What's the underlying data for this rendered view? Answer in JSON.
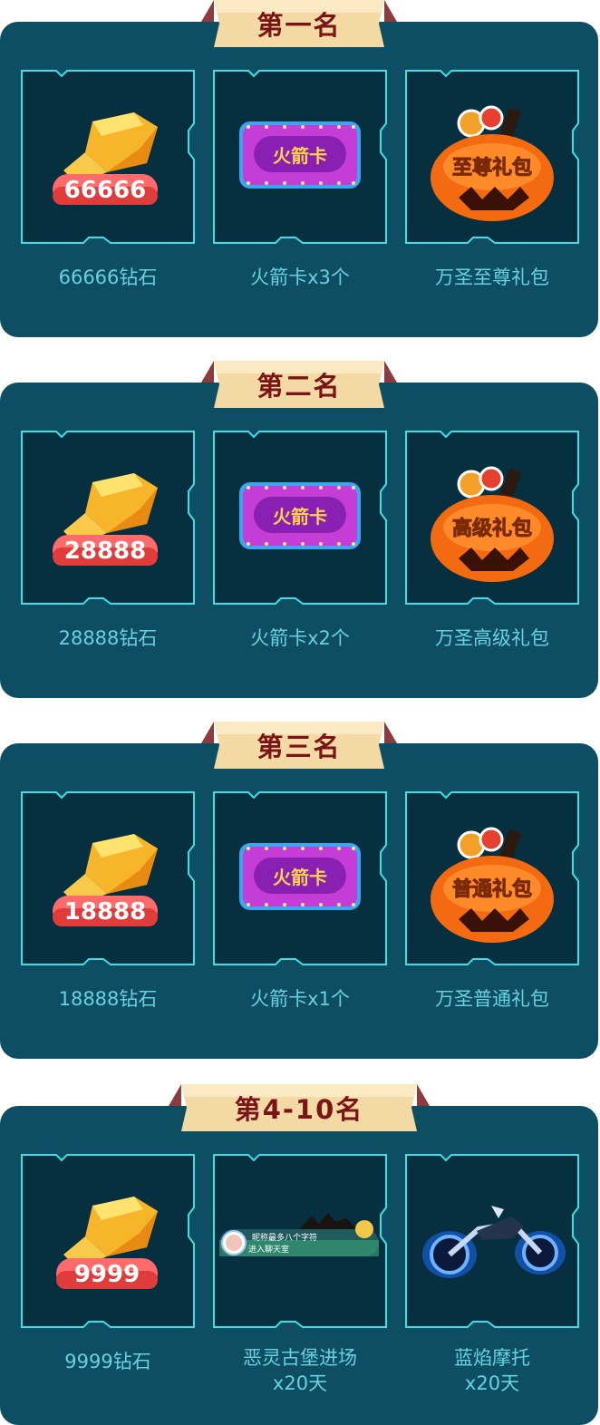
{
  "tiers": [
    {
      "title": "第一名",
      "rewards": [
        {
          "icon": "diamond-icon",
          "badge": "66666",
          "caption": "66666钻石"
        },
        {
          "icon": "rocket-card-icon",
          "badge": "火箭卡",
          "caption": "火箭卡x3个"
        },
        {
          "icon": "pumpkin-gift-icon",
          "badge": "至尊礼包",
          "caption": "万圣至尊礼包"
        }
      ]
    },
    {
      "title": "第二名",
      "rewards": [
        {
          "icon": "diamond-icon",
          "badge": "28888",
          "caption": "28888钻石"
        },
        {
          "icon": "rocket-card-icon",
          "badge": "火箭卡",
          "caption": "火箭卡x2个"
        },
        {
          "icon": "pumpkin-gift-icon",
          "badge": "高级礼包",
          "caption": "万圣高级礼包"
        }
      ]
    },
    {
      "title": "第三名",
      "rewards": [
        {
          "icon": "diamond-icon",
          "badge": "18888",
          "caption": "18888钻石"
        },
        {
          "icon": "rocket-card-icon",
          "badge": "火箭卡",
          "caption": "火箭卡x1个"
        },
        {
          "icon": "pumpkin-gift-icon",
          "badge": "普通礼包",
          "caption": "万圣普通礼包"
        }
      ]
    },
    {
      "title": "第4-10名",
      "rewards": [
        {
          "icon": "diamond-icon",
          "badge": "9999",
          "caption": "9999钻石"
        },
        {
          "icon": "castle-entrance-icon",
          "badge_line1": "昵称最多八个字符",
          "badge_line2": "进入聊天室",
          "caption_line1": "恶灵古堡进场",
          "caption_line2": "x20天"
        },
        {
          "icon": "blue-flame-motorcycle-icon",
          "caption_line1": "蓝焰摩托",
          "caption_line2": "x20天"
        }
      ]
    }
  ],
  "colors": {
    "panel": "#0e4e63",
    "card": "#06303f",
    "frame": "#3be0e6",
    "caption": "#67d1de",
    "banner": "#f3d9a4",
    "banner_text": "#7a1416"
  }
}
